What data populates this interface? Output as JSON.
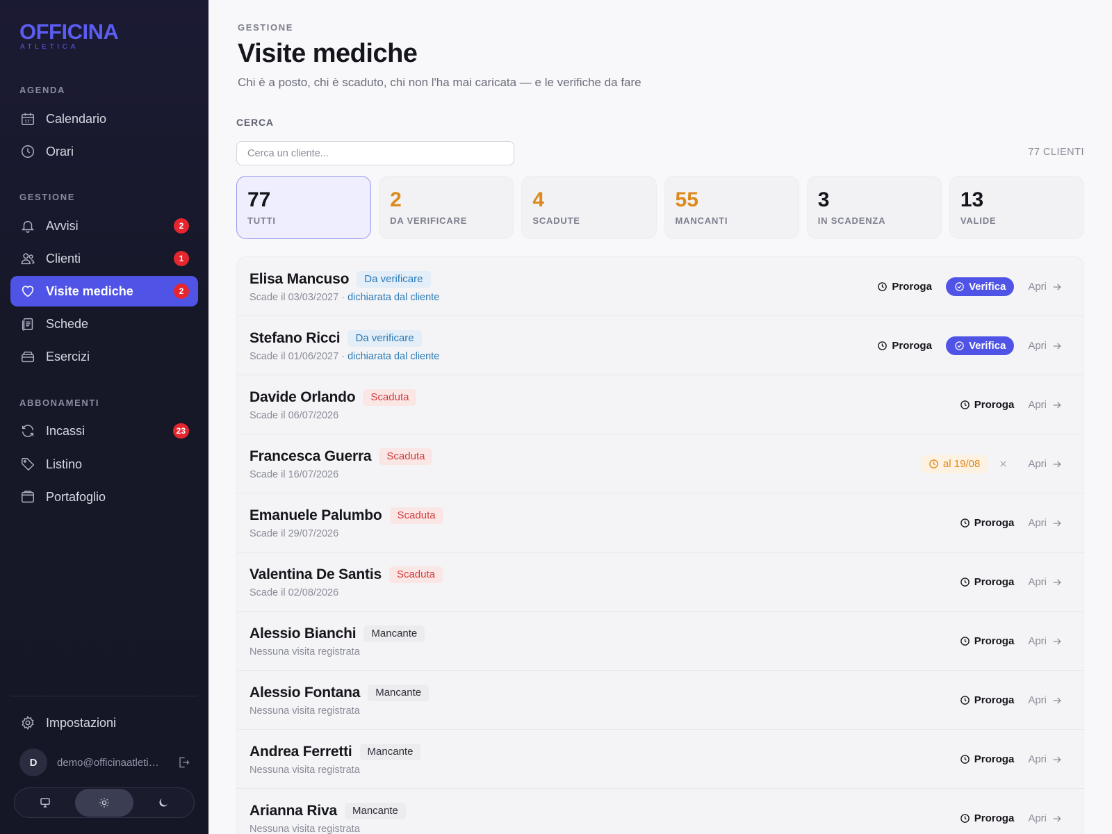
{
  "brand": {
    "name": "OFFICINA",
    "tagline": "ATLETICA",
    "color": "#5b5cf0"
  },
  "sidebar": {
    "sections": [
      {
        "title": "AGENDA",
        "items": [
          {
            "label": "Calendario",
            "icon": "calendar-icon"
          },
          {
            "label": "Orari",
            "icon": "clock-icon"
          }
        ]
      },
      {
        "title": "GESTIONE",
        "items": [
          {
            "label": "Avvisi",
            "icon": "bell-icon",
            "badge": "2"
          },
          {
            "label": "Clienti",
            "icon": "users-icon",
            "badge": "1"
          },
          {
            "label": "Visite mediche",
            "icon": "heart-icon",
            "badge": "2",
            "active": true
          },
          {
            "label": "Schede",
            "icon": "clipboard-icon"
          },
          {
            "label": "Esercizi",
            "icon": "box-icon"
          }
        ]
      },
      {
        "title": "ABBONAMENTI",
        "items": [
          {
            "label": "Incassi",
            "icon": "refresh-icon",
            "badge": "23"
          },
          {
            "label": "Listino",
            "icon": "tag-icon"
          },
          {
            "label": "Portafoglio",
            "icon": "wallet-icon"
          }
        ]
      }
    ],
    "settings_label": "Impostazioni",
    "user": {
      "initial": "D",
      "email": "demo@officinaatletica.it"
    },
    "theme": {
      "selected": "light",
      "options": [
        "system",
        "light",
        "dark"
      ]
    }
  },
  "header": {
    "eyebrow": "GESTIONE",
    "title": "Visite mediche",
    "subtitle": "Chi è a posto, chi è scaduto, chi non l'ha mai caricata — e le verifiche da fare"
  },
  "search": {
    "label": "CERCA",
    "placeholder": "Cerca un cliente...",
    "value": "",
    "count_label": "77 CLIENTI"
  },
  "stats": [
    {
      "value": "77",
      "label": "TUTTI",
      "color": "#15161c",
      "active": true
    },
    {
      "value": "2",
      "label": "DA VERIFICARE",
      "color": "#dd8a1c"
    },
    {
      "value": "4",
      "label": "SCADUTE",
      "color": "#dd8a1c"
    },
    {
      "value": "55",
      "label": "MANCANTI",
      "color": "#dd8a1c"
    },
    {
      "value": "3",
      "label": "IN SCADENZA",
      "color": "#15161c"
    },
    {
      "value": "13",
      "label": "VALIDE",
      "color": "#15161c"
    }
  ],
  "actions": {
    "proroga": "Proroga",
    "verifica": "Verifica",
    "apri": "Apri"
  },
  "clients": [
    {
      "name": "Elisa Mancuso",
      "status": "Da verificare",
      "kind": "verificare",
      "sub": "Scade il 03/03/2027 · ",
      "sub_link": "dichiarata dal cliente",
      "verify": true
    },
    {
      "name": "Stefano Ricci",
      "status": "Da verificare",
      "kind": "verificare",
      "sub": "Scade il 01/06/2027 · ",
      "sub_link": "dichiarata dal cliente",
      "verify": true
    },
    {
      "name": "Davide Orlando",
      "status": "Scaduta",
      "kind": "scaduta",
      "sub": "Scade il 06/07/2026"
    },
    {
      "name": "Francesca Guerra",
      "status": "Scaduta",
      "kind": "scaduta",
      "sub": "Scade il 16/07/2026",
      "extended_to": "al 19/08"
    },
    {
      "name": "Emanuele Palumbo",
      "status": "Scaduta",
      "kind": "scaduta",
      "sub": "Scade il 29/07/2026"
    },
    {
      "name": "Valentina De Santis",
      "status": "Scaduta",
      "kind": "scaduta",
      "sub": "Scade il 02/08/2026"
    },
    {
      "name": "Alessio Bianchi",
      "status": "Mancante",
      "kind": "mancante",
      "sub": "Nessuna visita registrata"
    },
    {
      "name": "Alessio Fontana",
      "status": "Mancante",
      "kind": "mancante",
      "sub": "Nessuna visita registrata"
    },
    {
      "name": "Andrea Ferretti",
      "status": "Mancante",
      "kind": "mancante",
      "sub": "Nessuna visita registrata"
    },
    {
      "name": "Arianna Riva",
      "status": "Mancante",
      "kind": "mancante",
      "sub": "Nessuna visita registrata"
    }
  ]
}
